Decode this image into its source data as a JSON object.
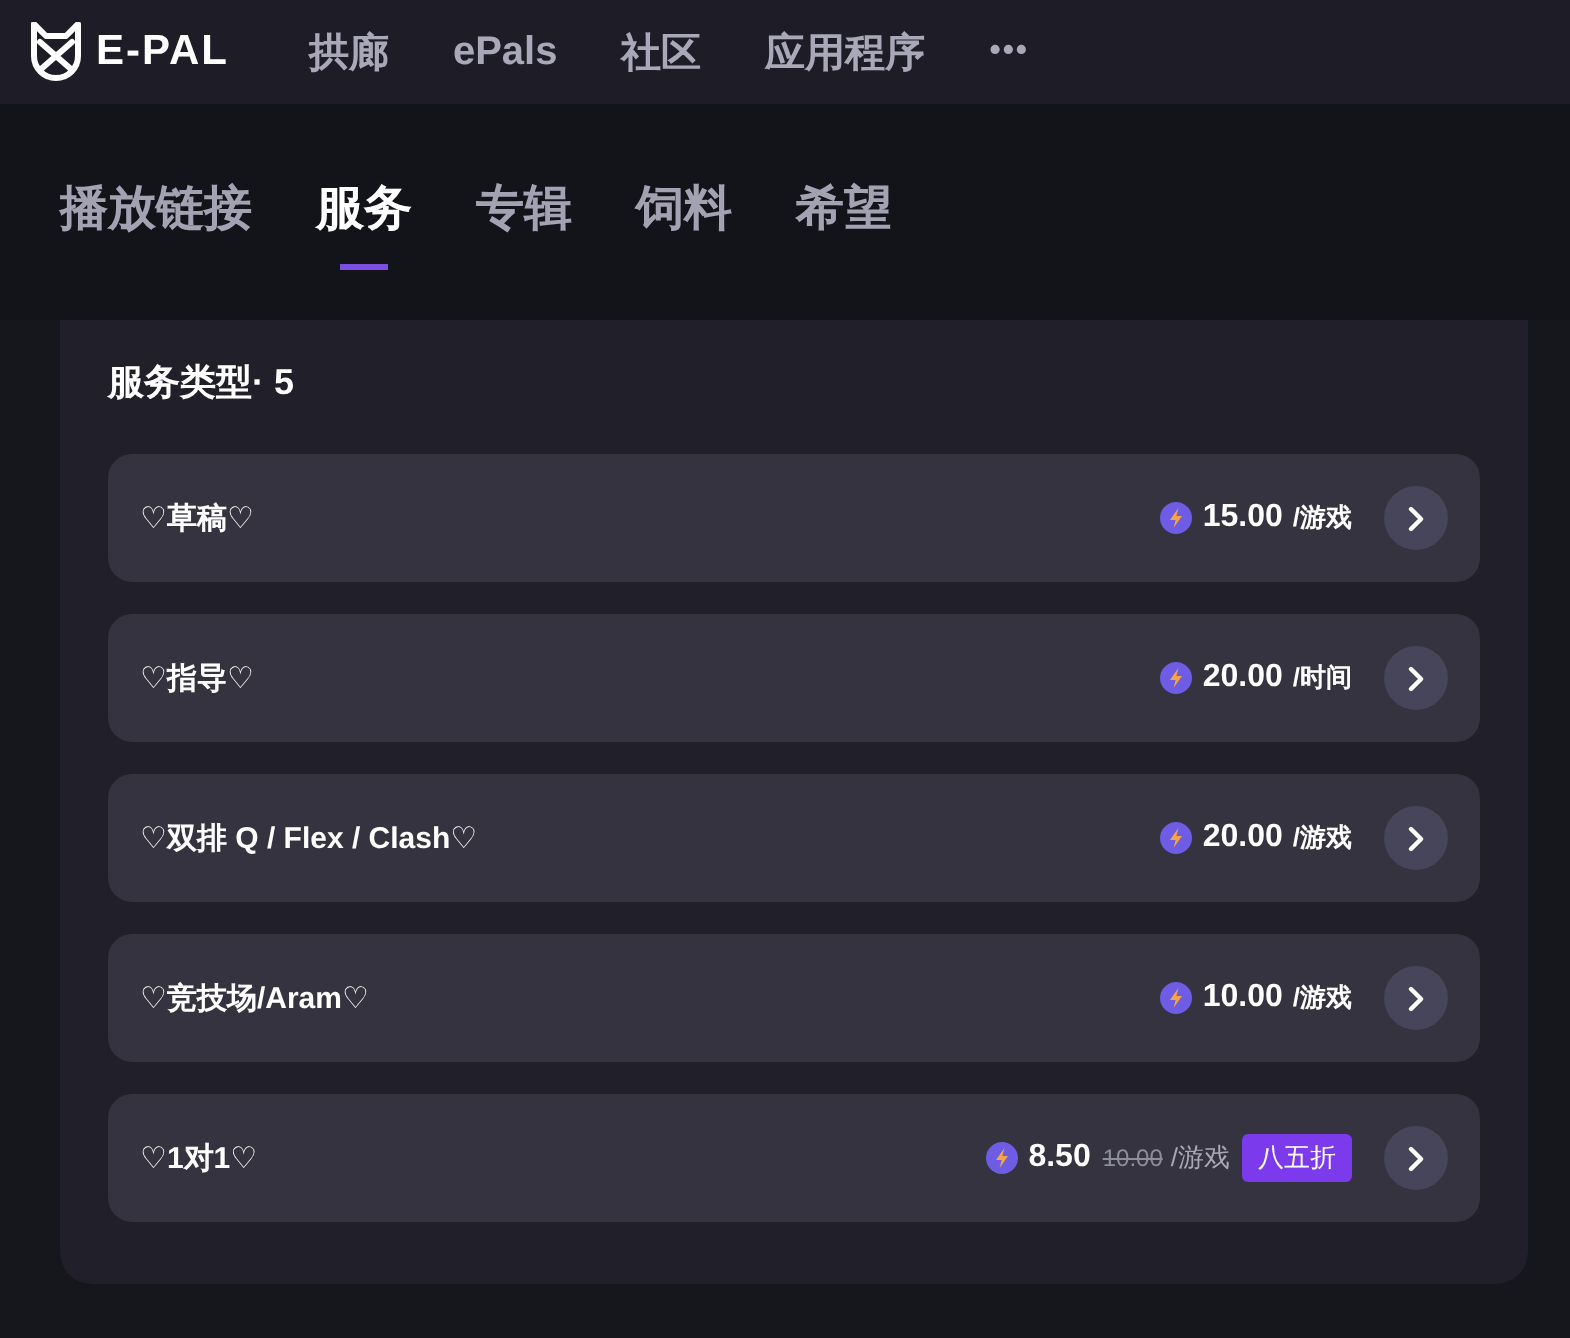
{
  "nav": {
    "logo": "E-PAL",
    "items": [
      {
        "label": "拱廊"
      },
      {
        "label": "ePals"
      },
      {
        "label": "社区"
      },
      {
        "label": "应用程序"
      }
    ],
    "more": "•••"
  },
  "tabs": [
    {
      "label": "播放链接",
      "selected": false
    },
    {
      "label": "服务",
      "selected": true
    },
    {
      "label": "专辑",
      "selected": false
    },
    {
      "label": "饲料",
      "selected": false
    },
    {
      "label": "希望",
      "selected": false
    }
  ],
  "services": {
    "title": "服务类型· 5",
    "items": [
      {
        "name": "♡草稿♡",
        "price": "15.00",
        "unit": "/游戏"
      },
      {
        "name": "♡指导♡",
        "price": "20.00",
        "unit": "/时间"
      },
      {
        "name": "♡双排 Q / Flex / Clash♡",
        "price": "20.00",
        "unit": "/游戏"
      },
      {
        "name": "♡竞技场/Aram♡",
        "price": "10.00",
        "unit": "/游戏"
      },
      {
        "name": "♡1对1♡",
        "price": "8.50",
        "original_price": "10.00",
        "unit": "/游戏",
        "discount": "八五折"
      }
    ]
  }
}
